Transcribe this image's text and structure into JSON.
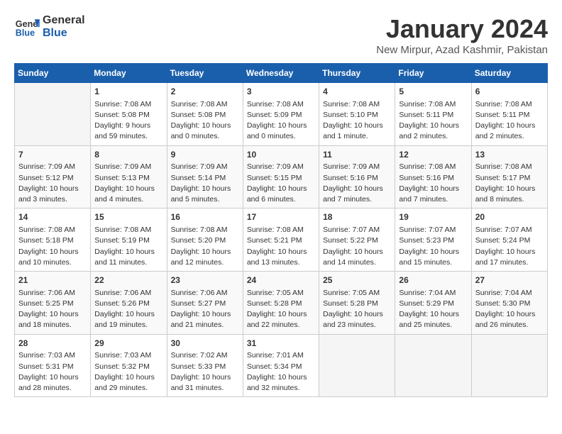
{
  "header": {
    "logo_line1": "General",
    "logo_line2": "Blue",
    "month_title": "January 2024",
    "subtitle": "New Mirpur, Azad Kashmir, Pakistan"
  },
  "days_of_week": [
    "Sunday",
    "Monday",
    "Tuesday",
    "Wednesday",
    "Thursday",
    "Friday",
    "Saturday"
  ],
  "weeks": [
    [
      {
        "day": "",
        "info": ""
      },
      {
        "day": "1",
        "info": "Sunrise: 7:08 AM\nSunset: 5:08 PM\nDaylight: 9 hours\nand 59 minutes."
      },
      {
        "day": "2",
        "info": "Sunrise: 7:08 AM\nSunset: 5:08 PM\nDaylight: 10 hours\nand 0 minutes."
      },
      {
        "day": "3",
        "info": "Sunrise: 7:08 AM\nSunset: 5:09 PM\nDaylight: 10 hours\nand 0 minutes."
      },
      {
        "day": "4",
        "info": "Sunrise: 7:08 AM\nSunset: 5:10 PM\nDaylight: 10 hours\nand 1 minute."
      },
      {
        "day": "5",
        "info": "Sunrise: 7:08 AM\nSunset: 5:11 PM\nDaylight: 10 hours\nand 2 minutes."
      },
      {
        "day": "6",
        "info": "Sunrise: 7:08 AM\nSunset: 5:11 PM\nDaylight: 10 hours\nand 2 minutes."
      }
    ],
    [
      {
        "day": "7",
        "info": "Sunrise: 7:09 AM\nSunset: 5:12 PM\nDaylight: 10 hours\nand 3 minutes."
      },
      {
        "day": "8",
        "info": "Sunrise: 7:09 AM\nSunset: 5:13 PM\nDaylight: 10 hours\nand 4 minutes."
      },
      {
        "day": "9",
        "info": "Sunrise: 7:09 AM\nSunset: 5:14 PM\nDaylight: 10 hours\nand 5 minutes."
      },
      {
        "day": "10",
        "info": "Sunrise: 7:09 AM\nSunset: 5:15 PM\nDaylight: 10 hours\nand 6 minutes."
      },
      {
        "day": "11",
        "info": "Sunrise: 7:09 AM\nSunset: 5:16 PM\nDaylight: 10 hours\nand 7 minutes."
      },
      {
        "day": "12",
        "info": "Sunrise: 7:08 AM\nSunset: 5:16 PM\nDaylight: 10 hours\nand 7 minutes."
      },
      {
        "day": "13",
        "info": "Sunrise: 7:08 AM\nSunset: 5:17 PM\nDaylight: 10 hours\nand 8 minutes."
      }
    ],
    [
      {
        "day": "14",
        "info": "Sunrise: 7:08 AM\nSunset: 5:18 PM\nDaylight: 10 hours\nand 10 minutes."
      },
      {
        "day": "15",
        "info": "Sunrise: 7:08 AM\nSunset: 5:19 PM\nDaylight: 10 hours\nand 11 minutes."
      },
      {
        "day": "16",
        "info": "Sunrise: 7:08 AM\nSunset: 5:20 PM\nDaylight: 10 hours\nand 12 minutes."
      },
      {
        "day": "17",
        "info": "Sunrise: 7:08 AM\nSunset: 5:21 PM\nDaylight: 10 hours\nand 13 minutes."
      },
      {
        "day": "18",
        "info": "Sunrise: 7:07 AM\nSunset: 5:22 PM\nDaylight: 10 hours\nand 14 minutes."
      },
      {
        "day": "19",
        "info": "Sunrise: 7:07 AM\nSunset: 5:23 PM\nDaylight: 10 hours\nand 15 minutes."
      },
      {
        "day": "20",
        "info": "Sunrise: 7:07 AM\nSunset: 5:24 PM\nDaylight: 10 hours\nand 17 minutes."
      }
    ],
    [
      {
        "day": "21",
        "info": "Sunrise: 7:06 AM\nSunset: 5:25 PM\nDaylight: 10 hours\nand 18 minutes."
      },
      {
        "day": "22",
        "info": "Sunrise: 7:06 AM\nSunset: 5:26 PM\nDaylight: 10 hours\nand 19 minutes."
      },
      {
        "day": "23",
        "info": "Sunrise: 7:06 AM\nSunset: 5:27 PM\nDaylight: 10 hours\nand 21 minutes."
      },
      {
        "day": "24",
        "info": "Sunrise: 7:05 AM\nSunset: 5:28 PM\nDaylight: 10 hours\nand 22 minutes."
      },
      {
        "day": "25",
        "info": "Sunrise: 7:05 AM\nSunset: 5:28 PM\nDaylight: 10 hours\nand 23 minutes."
      },
      {
        "day": "26",
        "info": "Sunrise: 7:04 AM\nSunset: 5:29 PM\nDaylight: 10 hours\nand 25 minutes."
      },
      {
        "day": "27",
        "info": "Sunrise: 7:04 AM\nSunset: 5:30 PM\nDaylight: 10 hours\nand 26 minutes."
      }
    ],
    [
      {
        "day": "28",
        "info": "Sunrise: 7:03 AM\nSunset: 5:31 PM\nDaylight: 10 hours\nand 28 minutes."
      },
      {
        "day": "29",
        "info": "Sunrise: 7:03 AM\nSunset: 5:32 PM\nDaylight: 10 hours\nand 29 minutes."
      },
      {
        "day": "30",
        "info": "Sunrise: 7:02 AM\nSunset: 5:33 PM\nDaylight: 10 hours\nand 31 minutes."
      },
      {
        "day": "31",
        "info": "Sunrise: 7:01 AM\nSunset: 5:34 PM\nDaylight: 10 hours\nand 32 minutes."
      },
      {
        "day": "",
        "info": ""
      },
      {
        "day": "",
        "info": ""
      },
      {
        "day": "",
        "info": ""
      }
    ]
  ]
}
